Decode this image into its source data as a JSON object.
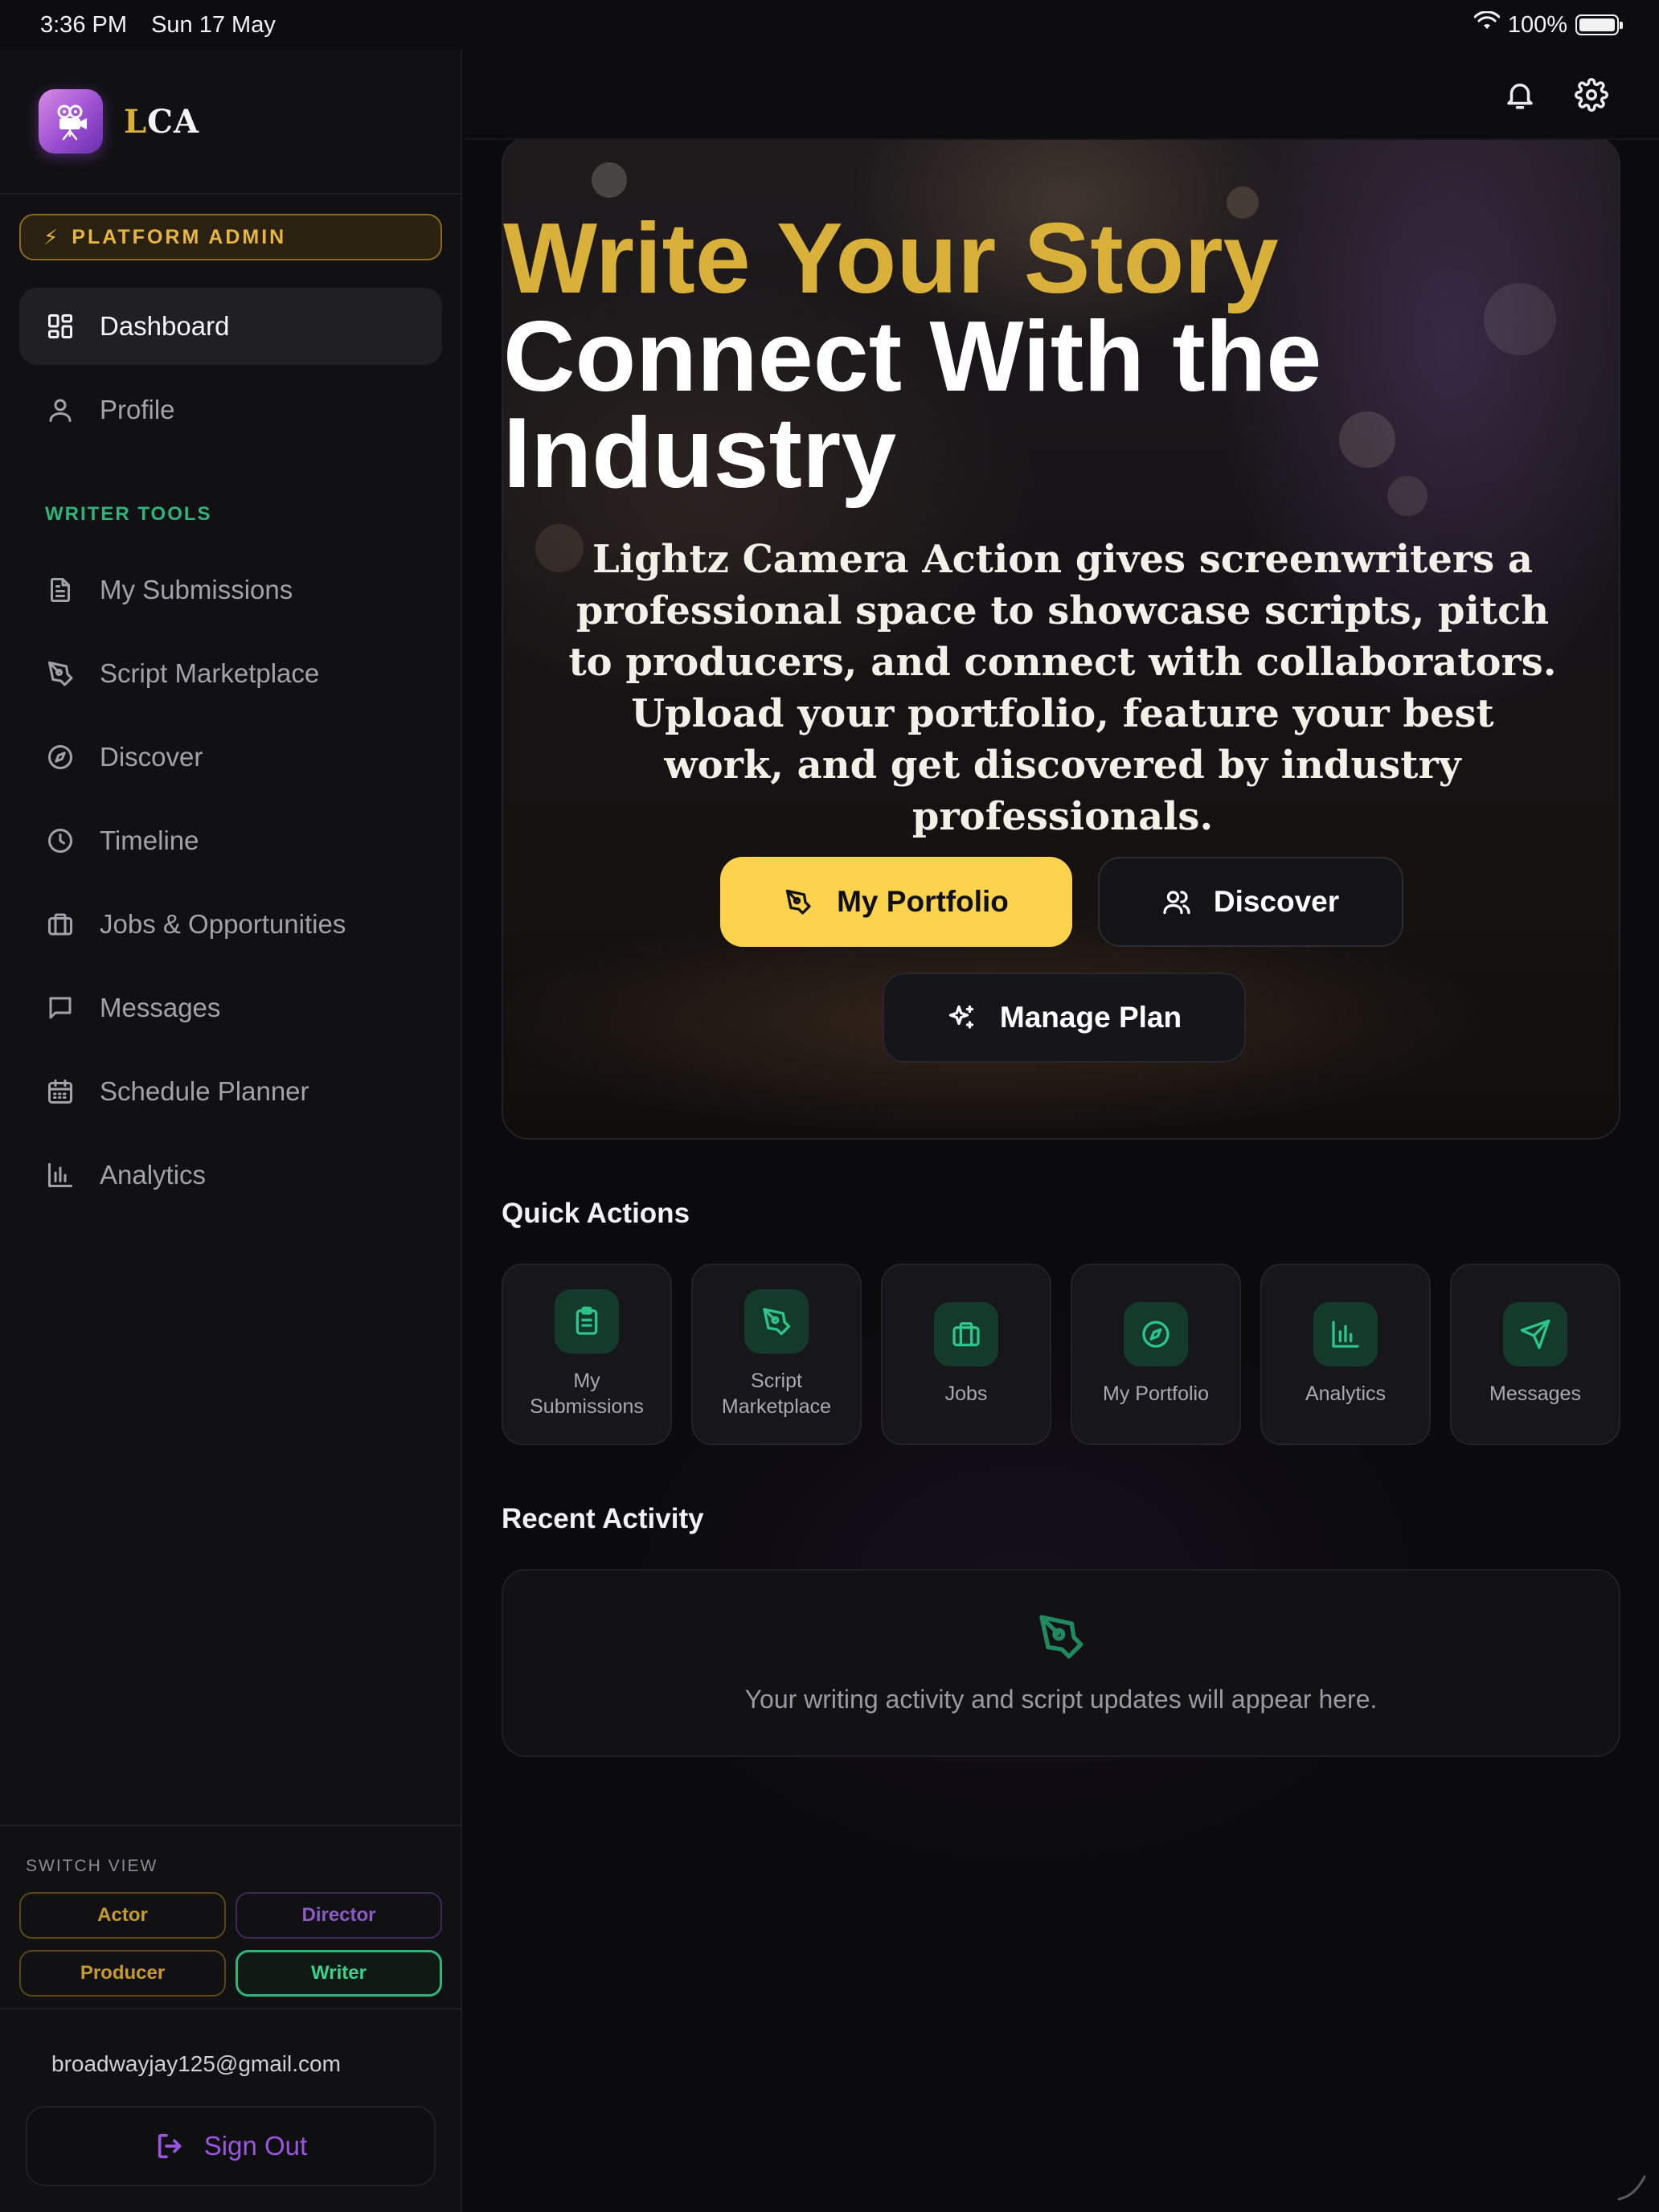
{
  "status_bar": {
    "time": "3:36 PM",
    "date": "Sun 17 May",
    "battery": "100%"
  },
  "brand": {
    "name_first": "L",
    "name_rest": "CA"
  },
  "admin_badge": {
    "icon": "⚡",
    "label": "PLATFORM ADMIN"
  },
  "nav": {
    "primary": [
      {
        "label": "Dashboard",
        "icon": "dashboard-icon",
        "active": true
      },
      {
        "label": "Profile",
        "icon": "user-icon"
      }
    ],
    "section_label": "WRITER TOOLS",
    "tools": [
      {
        "label": "My Submissions",
        "icon": "document-icon"
      },
      {
        "label": "Script Marketplace",
        "icon": "pen-nib-icon"
      },
      {
        "label": "Discover",
        "icon": "compass-icon"
      },
      {
        "label": "Timeline",
        "icon": "clock-icon"
      },
      {
        "label": "Jobs & Opportunities",
        "icon": "briefcase-icon"
      },
      {
        "label": "Messages",
        "icon": "message-icon"
      },
      {
        "label": "Schedule Planner",
        "icon": "calendar-icon"
      },
      {
        "label": "Analytics",
        "icon": "bar-chart-icon"
      }
    ]
  },
  "switch_view": {
    "label": "SWITCH VIEW",
    "options": [
      "Actor",
      "Director",
      "Producer",
      "Writer"
    ],
    "selected": "Writer"
  },
  "user": {
    "email": "broadwayjay125@gmail.com",
    "sign_out": "Sign Out"
  },
  "hero": {
    "title_gold": "Write Your Story",
    "title_line2": "Connect With the",
    "title_line3": "Industry",
    "description": "Lightz Camera Action gives screenwriters a professional space to showcase scripts, pitch to producers, and connect with collaborators. Upload your portfolio, feature your best work, and get discovered by industry professionals.",
    "btn_portfolio": "My Portfolio",
    "btn_discover": "Discover",
    "btn_plan": "Manage Plan"
  },
  "quick_actions": {
    "title": "Quick Actions",
    "items": [
      {
        "label": "My Submissions",
        "icon": "clipboard-icon"
      },
      {
        "label": "Script Marketplace",
        "icon": "pen-nib-icon"
      },
      {
        "label": "Jobs",
        "icon": "briefcase-icon"
      },
      {
        "label": "My Portfolio",
        "icon": "compass-icon"
      },
      {
        "label": "Analytics",
        "icon": "bar-chart-icon"
      },
      {
        "label": "Messages",
        "icon": "send-icon"
      }
    ]
  },
  "recent_activity": {
    "title": "Recent Activity",
    "empty_text": "Your writing activity and script updates will appear here."
  },
  "colors": {
    "accent_gold": "#d9b03a",
    "button_yellow": "#fdd34d",
    "writer_green": "#2fb57c",
    "purple": "#9b55e0"
  }
}
